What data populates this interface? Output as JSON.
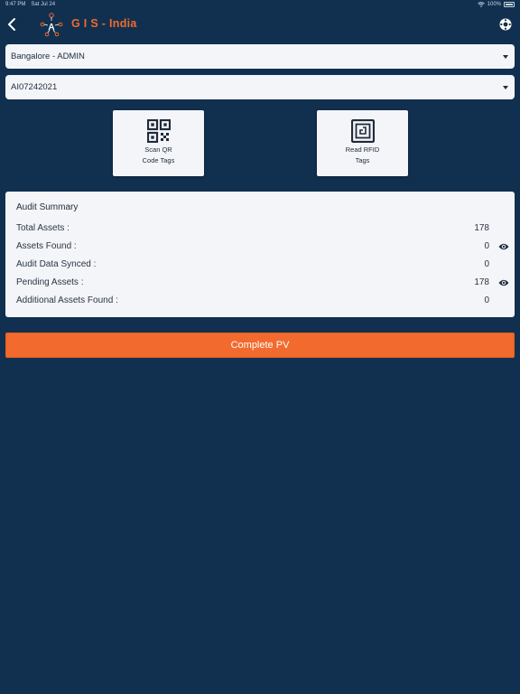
{
  "status_bar": {
    "time": "9:47 PM",
    "date": "Sat Jul 24",
    "battery": "100%"
  },
  "header": {
    "title": "G I S - India",
    "back_icon": "chevron-left-icon",
    "settings_icon": "settings-icon"
  },
  "dropdowns": {
    "location": "Bangalore - ADMIN",
    "audit_id": "AI07242021"
  },
  "actions": {
    "scan_qr": {
      "line1": "Scan QR",
      "line2": "Code Tags",
      "icon": "qr-code-icon"
    },
    "read_rfid": {
      "line1": "Read RFID",
      "line2": "Tags",
      "icon": "rfid-icon"
    }
  },
  "summary": {
    "heading": "Audit Summary",
    "rows": [
      {
        "label": "Total Assets :",
        "value": "178"
      },
      {
        "label": "Assets Found :",
        "value": "0"
      },
      {
        "label": "Audit Data Synced :",
        "value": "0"
      },
      {
        "label": "Pending Assets :",
        "value": "178"
      },
      {
        "label": "Additional Assets Found :",
        "value": "0"
      }
    ]
  },
  "complete_button": "Complete PV",
  "colors": {
    "background": "#11304f",
    "accent": "#f26a2e",
    "card": "#f4f5f9"
  }
}
